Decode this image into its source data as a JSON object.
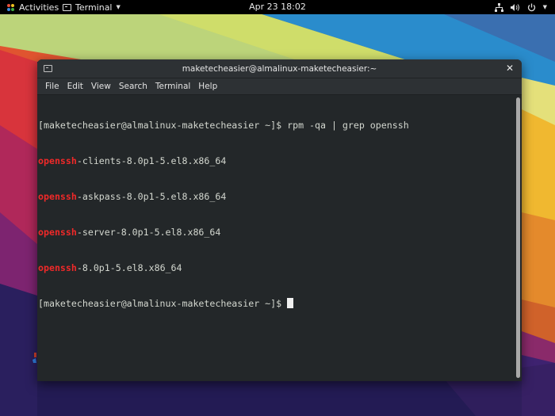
{
  "topbar": {
    "activities_label": "Activities",
    "app_menu_label": "Terminal",
    "clock": "Apr 23  18:02",
    "status_icons": [
      "network-icon",
      "volume-icon",
      "power-icon",
      "chevron-down-icon"
    ]
  },
  "window": {
    "title": "maketecheasier@almalinux-maketecheasier:~",
    "close_glyph": "✕",
    "menu": [
      "File",
      "Edit",
      "View",
      "Search",
      "Terminal",
      "Help"
    ]
  },
  "terminal": {
    "prompt": "[maketecheasier@almalinux-maketecheasier ~]$ ",
    "command": "rpm -qa | grep openssh",
    "match": "openssh",
    "results": [
      "-clients-8.0p1-5.el8.x86_64",
      "-askpass-8.0p1-5.el8.x86_64",
      "-server-8.0p1-5.el8.x86_64",
      "-8.0p1-5.el8.x86_64"
    ],
    "highlight_color": "#ef2929"
  }
}
